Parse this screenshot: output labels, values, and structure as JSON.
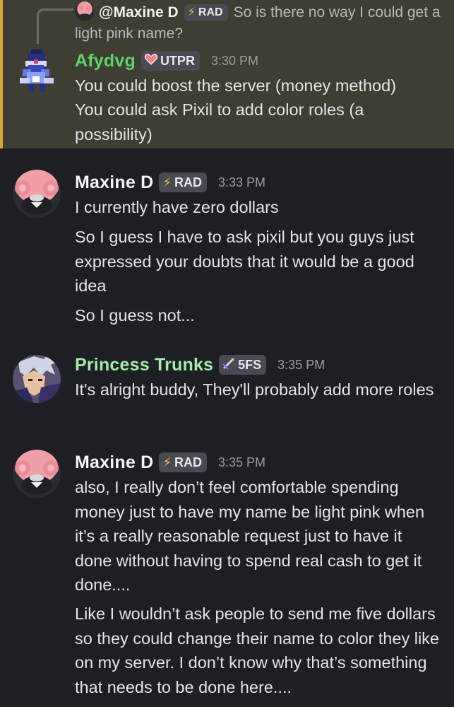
{
  "colors": {
    "background": "#1e1f24",
    "highlight_bg": "#3f3e32",
    "highlight_bar": "#d8a634",
    "afydvg_name": "#5cd36a",
    "trunks_name": "#9df0a6",
    "default_name": "#f3f4f6"
  },
  "reply": {
    "author": "@Maxine D",
    "badge_icon": "⚡",
    "badge": "RAD",
    "text": "So is there no way I could get a light pink name?"
  },
  "messages": [
    {
      "author": "Afydvg",
      "badge_icon": "heart-icon",
      "badge": "UTPR",
      "time": "3:30 PM",
      "lines": [
        "You could boost the server (money method)",
        "You could ask Pixil to add color roles (a possibility)"
      ]
    },
    {
      "author": "Maxine D",
      "badge_icon": "⚡",
      "badge": "RAD",
      "time": "3:33 PM",
      "lines": [
        "I currently have zero dollars",
        "So I guess I have to ask pixil but you guys just expressed your doubts that it would be a good idea",
        "So I guess not..."
      ]
    },
    {
      "author": "Princess Trunks",
      "badge_icon": "sword-icon",
      "badge": "5FS",
      "time": "3:35 PM",
      "lines": [
        "It's alright buddy, They'll probably add more roles"
      ]
    },
    {
      "author": "Maxine D",
      "badge_icon": "⚡",
      "badge": "RAD",
      "time": "3:35 PM",
      "lines": [
        "also, I really don’t feel comfortable spending money just to have my name be light pink when it’s a really reasonable request just to have it done without having to spend real cash to get it done....",
        "Like I wouldn’t ask people to send me five dollars so they could change their name to color they like on my server. I don’t know why that’s something that needs to be done here...."
      ]
    }
  ]
}
